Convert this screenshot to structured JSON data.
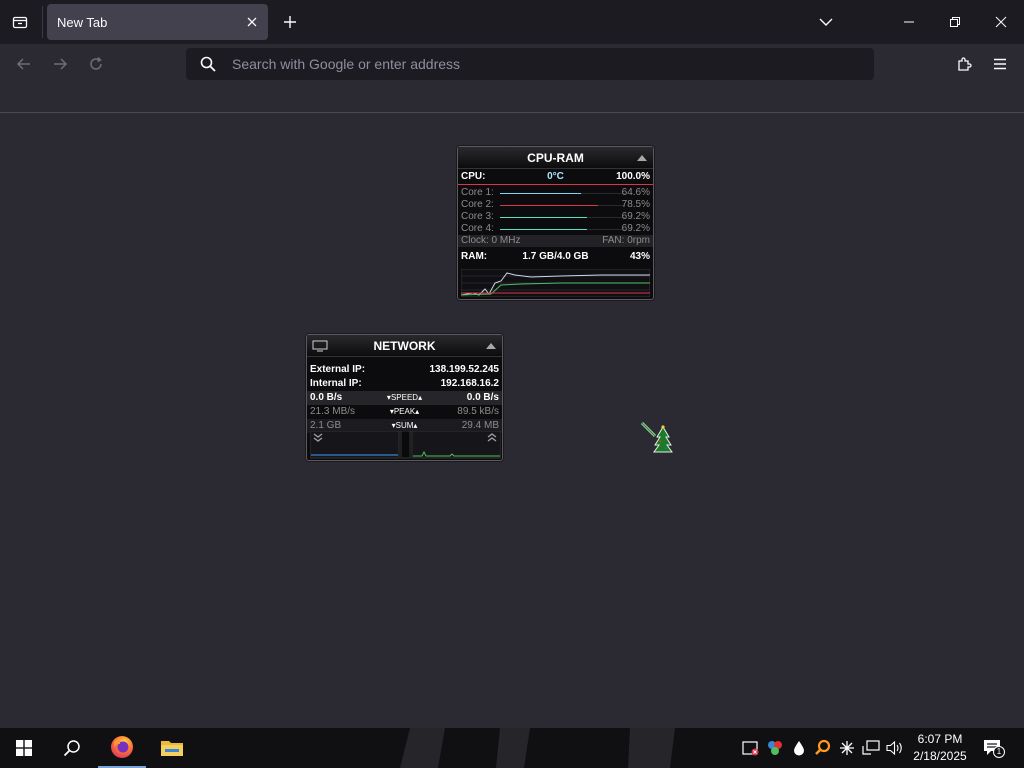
{
  "browser": {
    "tab": {
      "title": "New Tab"
    },
    "urlbar": {
      "placeholder": "Search with Google or enter address"
    }
  },
  "cpu_ram": {
    "title": "CPU-RAM",
    "cpu_label": "CPU:",
    "temp": "0°C",
    "cpu_total": "100.0%",
    "cores": [
      {
        "label": "Core 1:",
        "value": "64.6%",
        "fraction": 0.646,
        "color": "#7fd3f0"
      },
      {
        "label": "Core 2:",
        "value": "78.5%",
        "fraction": 0.785,
        "color": "#d9364a"
      },
      {
        "label": "Core 3:",
        "value": "69.2%",
        "fraction": 0.692,
        "color": "#5ce0c0"
      },
      {
        "label": "Core 4:",
        "value": "69.2%",
        "fraction": 0.692,
        "color": "#5ce0c0"
      }
    ],
    "clock": "Clock: 0 MHz",
    "fan": "FAN: 0rpm",
    "ram_label": "RAM:",
    "ram_value": "1.7 GB/4.0 GB",
    "ram_percent": "43%"
  },
  "network": {
    "title": "NETWORK",
    "external_ip_label": "External IP:",
    "external_ip": "138.199.52.245",
    "internal_ip_label": "Internal IP:",
    "internal_ip": "192.168.16.2",
    "speed": {
      "down": "0.0 B/s",
      "label": "SPEED",
      "up": "0.0 B/s"
    },
    "peak": {
      "down": "21.3 MB/s",
      "label": "PEAK",
      "up": "89.5 kB/s"
    },
    "sum": {
      "down": "2.1 GB",
      "label": "SUM",
      "up": "29.4 MB"
    }
  },
  "taskbar": {
    "clock_time": "6:07 PM",
    "clock_date": "2/18/2025",
    "notification_count": "1"
  },
  "colors": {
    "tab_bg": "#42414d",
    "page_bg": "#2b2a33",
    "urlbar_bg": "#1c1b22",
    "ram_bar": "#3aa0ff",
    "cpu_line": "#d9364a"
  },
  "icons": {
    "tab_list": "tab-list-icon",
    "search": "search-icon",
    "extensions": "puzzle-icon",
    "menu": "hamburger-icon",
    "windows": "windows-logo-icon",
    "taskbar_search": "search-icon",
    "firefox": "firefox-icon",
    "file_explorer": "folder-icon"
  }
}
